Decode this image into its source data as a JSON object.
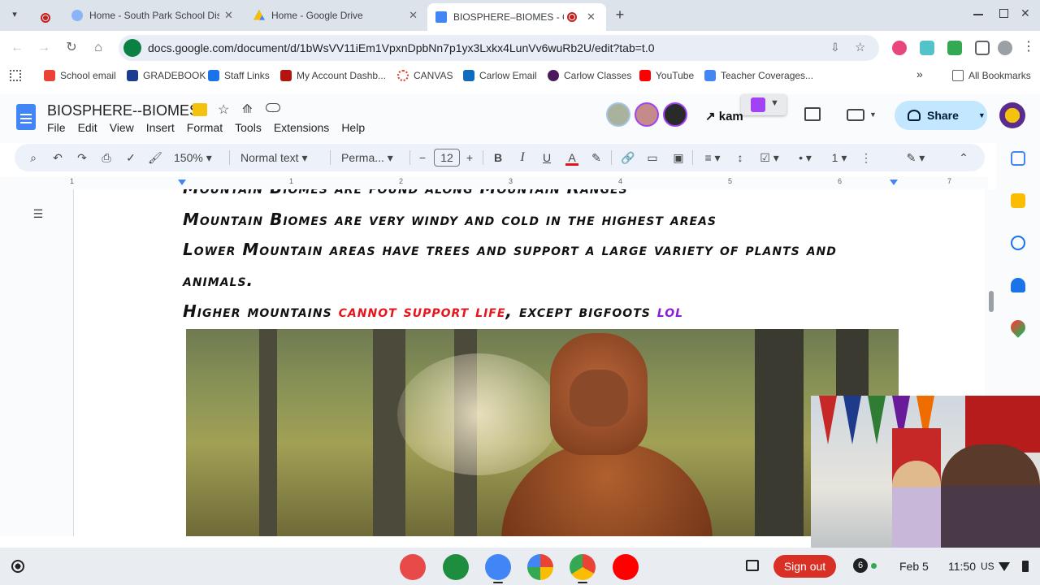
{
  "browser": {
    "tabs": [
      {
        "title": "Home - South Park School Dist",
        "active": false
      },
      {
        "title": "Home - Google Drive",
        "active": false
      },
      {
        "title": "BIOSPHERE–BIOMES - Goo",
        "active": true
      }
    ],
    "new_tab_symbol": "+",
    "url": "docs.google.com/document/d/1bWsVV11iEm1VpxnDpbNn7p1yx3Lxkx4LunVv6wuRb2U/edit?tab=t.0"
  },
  "bookmarks": {
    "items": [
      "School email",
      "GRADEBOOK",
      "Staff Links",
      "My Account Dashb...",
      "CANVAS",
      "Carlow Email",
      "Carlow Classes",
      "YouTube",
      "Teacher Coverages..."
    ],
    "overflow": "»",
    "all_bookmarks": "All Bookmarks"
  },
  "docs": {
    "title": "BIOSPHERE--BIOMES",
    "menu": [
      "File",
      "Edit",
      "View",
      "Insert",
      "Format",
      "Tools",
      "Extensions",
      "Help"
    ],
    "kami_label": "kam",
    "share_label": "Share"
  },
  "toolbar": {
    "zoom": "150%",
    "style": "Normal text",
    "font": "Perma...",
    "font_size": "12",
    "bold": "B",
    "italic": "I",
    "underline": "U",
    "text_color": "A"
  },
  "ruler": {
    "labels": [
      "1",
      "1",
      "2",
      "3",
      "4",
      "5",
      "6",
      "7"
    ]
  },
  "document": {
    "line0": "Mountain Biomes are found along Mountain Ranges",
    "line1": "Mountain Biomes are very windy and cold in the highest areas",
    "line2": "Lower Mountain areas have trees and support a large variety of plants and",
    "line3": "animals.",
    "line4_a": "Higher mountains ",
    "line4_b": "cannot support life",
    "line4_c": ", except  bigfoots  ",
    "line4_d": "lol"
  },
  "colors": {
    "red_text": "#e8141c",
    "purple_text": "#8a1ed6",
    "share_bg": "#c2e7ff",
    "signout_bg": "#d93025"
  },
  "shelf": {
    "sign_out": "Sign out",
    "notif_count": "6",
    "date": "Feb 5",
    "time": "11:50",
    "locale": "US"
  }
}
